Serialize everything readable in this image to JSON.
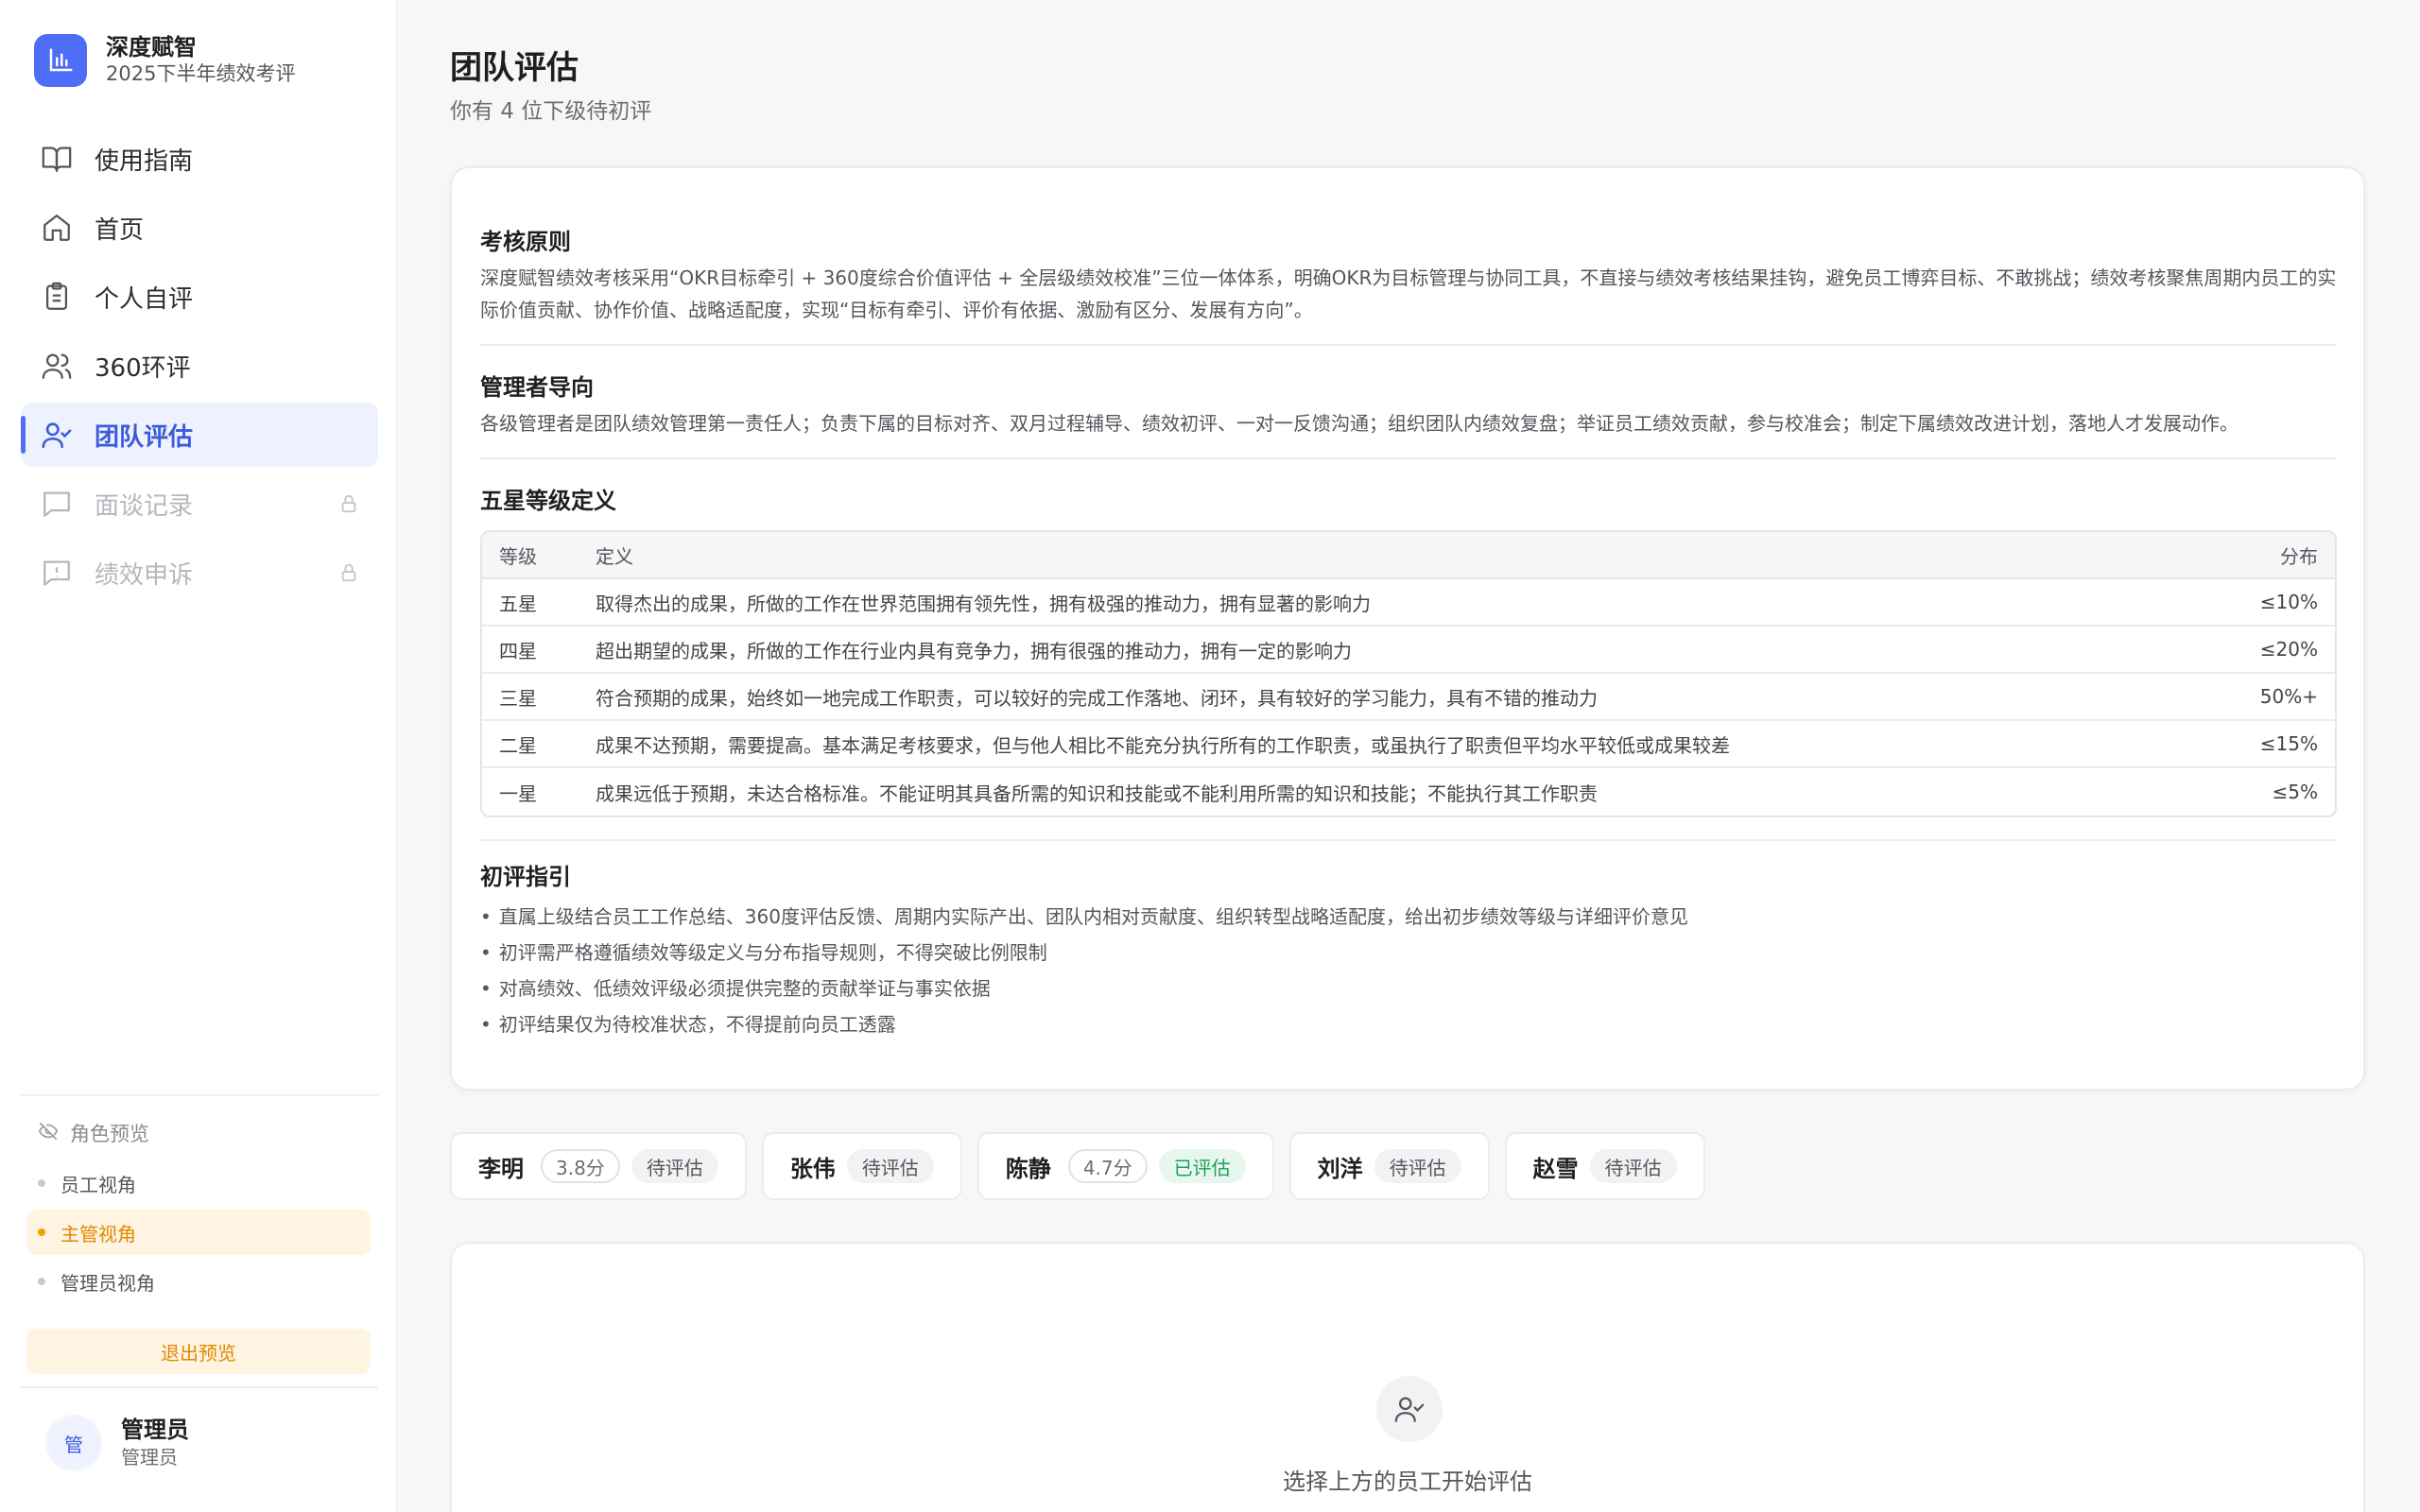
{
  "brand": {
    "name": "深度赋智",
    "subtitle": "2025下半年绩效考评",
    "color": "#4f6ef7"
  },
  "nav": {
    "items": [
      {
        "label": "使用指南",
        "icon": "book-icon",
        "state": "normal"
      },
      {
        "label": "首页",
        "icon": "home-icon",
        "state": "normal"
      },
      {
        "label": "个人自评",
        "icon": "clipboard-icon",
        "state": "normal"
      },
      {
        "label": "360环评",
        "icon": "users-icon",
        "state": "normal"
      },
      {
        "label": "团队评估",
        "icon": "user-check-icon",
        "state": "active"
      },
      {
        "label": "面谈记录",
        "icon": "message-icon",
        "state": "locked"
      },
      {
        "label": "绩效申诉",
        "icon": "alert-message-icon",
        "state": "locked"
      }
    ]
  },
  "preview": {
    "title": "角色预览",
    "options": [
      {
        "label": "员工视角",
        "active": false
      },
      {
        "label": "主管视角",
        "active": true
      },
      {
        "label": "管理员视角",
        "active": false
      }
    ],
    "exit_label": "退出预览"
  },
  "user": {
    "avatar_text": "管",
    "name": "管理员",
    "role": "管理员"
  },
  "page": {
    "title": "团队评估",
    "subtitle": "你有 4 位下级待初评"
  },
  "principles": {
    "title": "考核原则",
    "text": "深度赋智绩效考核采用“OKR目标牵引 + 360度综合价值评估 + 全层级绩效校准”三位一体体系，明确OKR为目标管理与协同工具，不直接与绩效考核结果挂钩，避免员工博弈目标、不敢挑战；绩效考核聚焦周期内员工的实际价值贡献、协作价值、战略适配度，实现“目标有牵引、评价有依据、激励有区分、发展有方向”。"
  },
  "manager": {
    "title": "管理者导向",
    "text": "各级管理者是团队绩效管理第一责任人；负责下属的目标对齐、双月过程辅导、绩效初评、一对一反馈沟通；组织团队内绩效复盘；举证员工绩效贡献，参与校准会；制定下属绩效改进计划，落地人才发展动作。"
  },
  "levels": {
    "title": "五星等级定义",
    "headers": {
      "level": "等级",
      "definition": "定义",
      "distribution": "分布"
    },
    "rows": [
      {
        "level": "五星",
        "definition": "取得杰出的成果，所做的工作在世界范围拥有领先性，拥有极强的推动力，拥有显著的影响力",
        "distribution": "≤10%"
      },
      {
        "level": "四星",
        "definition": "超出期望的成果，所做的工作在行业内具有竞争力，拥有很强的推动力，拥有一定的影响力",
        "distribution": "≤20%"
      },
      {
        "level": "三星",
        "definition": "符合预期的成果，始终如一地完成工作职责，可以较好的完成工作落地、闭环，具有较好的学习能力，具有不错的推动力",
        "distribution": "50%+"
      },
      {
        "level": "二星",
        "definition": "成果不达预期，需要提高。基本满足考核要求，但与他人相比不能充分执行所有的工作职责，或虽执行了职责但平均水平较低或成果较差",
        "distribution": "≤15%"
      },
      {
        "level": "一星",
        "definition": "成果远低于预期，未达合格标准。不能证明其具备所需的知识和技能或不能利用所需的知识和技能；不能执行其工作职责",
        "distribution": "≤5%"
      }
    ]
  },
  "guide": {
    "title": "初评指引",
    "items": [
      "直属上级结合员工工作总结、360度评估反馈、周期内实际产出、团队内相对贡献度、组织转型战略适配度，给出初步绩效等级与详细评价意见",
      "初评需严格遵循绩效等级定义与分布指导规则，不得突破比例限制",
      "对高绩效、低绩效评级必须提供完整的贡献举证与事实依据",
      "初评结果仅为待校准状态，不得提前向员工透露"
    ]
  },
  "employees": [
    {
      "name": "李明",
      "score": "3.8分",
      "status": "待评估",
      "done": false
    },
    {
      "name": "张伟",
      "score": "",
      "status": "待评估",
      "done": false
    },
    {
      "name": "陈静",
      "score": "4.7分",
      "status": "已评估",
      "done": true
    },
    {
      "name": "刘洋",
      "score": "",
      "status": "待评估",
      "done": false
    },
    {
      "name": "赵雪",
      "score": "",
      "status": "待评估",
      "done": false
    }
  ],
  "empty_state": {
    "icon": "user-check-icon",
    "text": "选择上方的员工开始评估"
  },
  "colors": {
    "accent": "#4f6ef7",
    "warning": "#e08a00",
    "success": "#1e9e5a"
  }
}
